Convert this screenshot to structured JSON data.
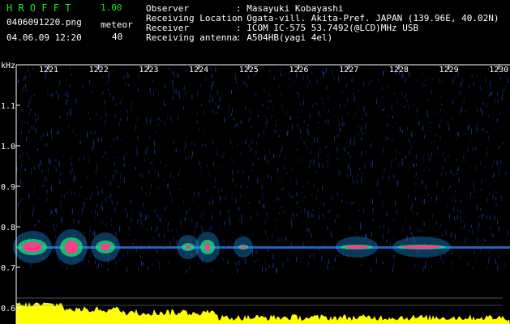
{
  "header": {
    "app_title": "HROFFT",
    "app_version": "1.00",
    "filename": "0406091220.png",
    "datetime": "04.06.09 12:20",
    "meteor_label": "meteor",
    "meteor_count": "40",
    "meta": [
      {
        "key": "Observer",
        "value": ": Masayuki Kobayashi"
      },
      {
        "key": "Receiving Location",
        "value": ": Ogata-vill. Akita-Pref. JAPAN (139.96E, 40.02N)"
      },
      {
        "key": "Receiver",
        "value": ": ICOM IC-575 53.7492(@LCD)MHz USB"
      },
      {
        "key": "Receiving antenna",
        "value": ": A504HB(yagi 4el)"
      }
    ]
  },
  "spectrogram": {
    "y_unit": "kHz",
    "y_ticks": [
      "1.1",
      "1.0",
      "0.9",
      "0.8",
      "0.7",
      "0.6"
    ],
    "x_ticks": [
      "1221",
      "1222",
      "1223",
      "1224",
      "1225",
      "1226",
      "1227",
      "1228",
      "1229",
      "1230"
    ],
    "colors": {
      "background": "#000000",
      "axis": "#ffffff",
      "noise": "#1e46c8",
      "signal_core": "#ff3c8c",
      "power_fill": "#ffff00"
    }
  }
}
